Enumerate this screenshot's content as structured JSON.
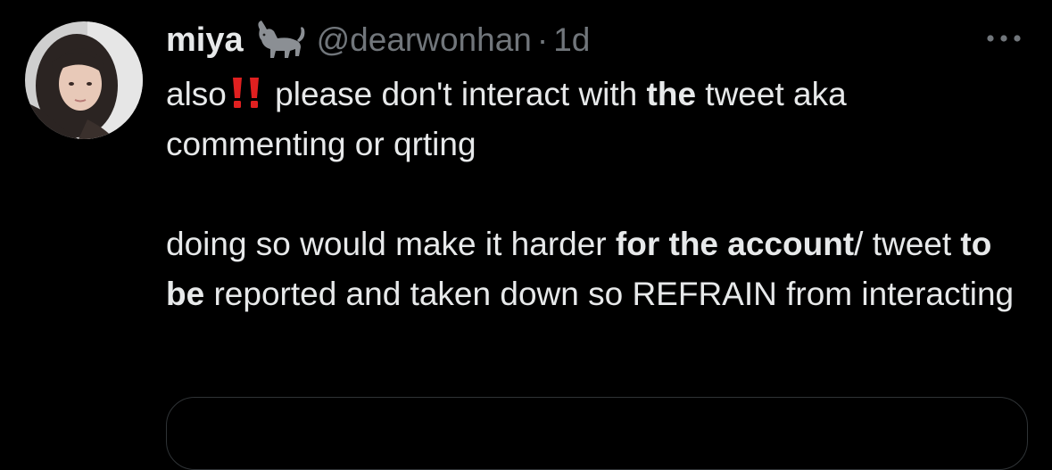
{
  "author": {
    "name": "miya",
    "name_emoji": "cat",
    "handle": "@dearwonhan",
    "separator": "·",
    "time": "1d"
  },
  "body": {
    "p1": {
      "t1": "also",
      "emoji": "double-exclamation",
      "t2": " please don't interact with ",
      "b1": "the",
      "t3": " tweet aka commenting or qrting"
    },
    "p2": {
      "t1": "doing so would make it harder ",
      "b1": "for the account",
      "t2": "/ tweet ",
      "b2": "to be",
      "t3": " reported and taken down so REFRAIN from interacting"
    }
  },
  "colors": {
    "background": "#000000",
    "text": "#e7e9ea",
    "secondary": "#71767b",
    "emoji_red": "#e02020"
  }
}
